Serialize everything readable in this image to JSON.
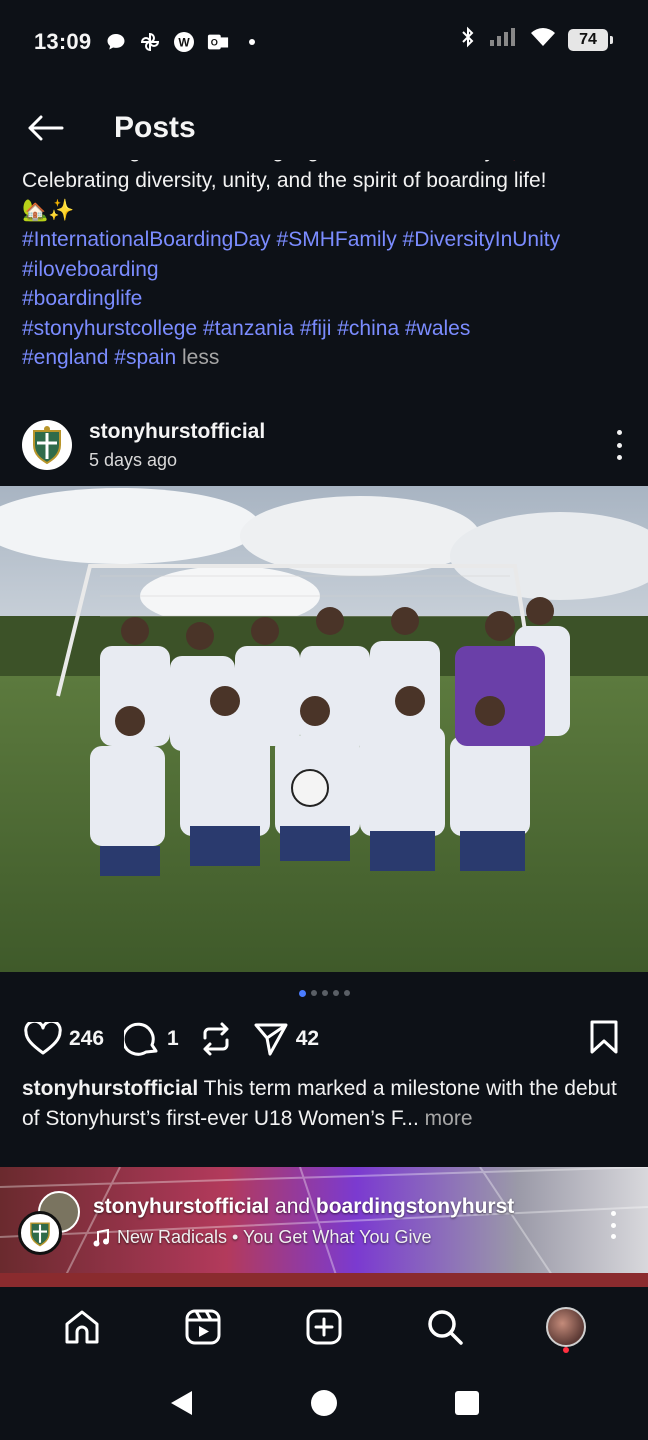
{
  "status_bar": {
    "time": "13:09",
    "battery": "74",
    "left_icons": [
      "chat-bubble-icon",
      "pinwheel-icon",
      "w-app-icon",
      "outlook-icon",
      "dot-icon"
    ],
    "right_icons": [
      "bluetooth-icon",
      "signal-icon",
      "wifi-icon",
      "battery-icon"
    ]
  },
  "header": {
    "title": "Posts"
  },
  "prev_post": {
    "caption_cut_line": "Different flags, different languages, one community ❤️",
    "caption_line": "Celebrating diversity, unity, and the spirit of boarding life!",
    "emoji_line": "🏡✨",
    "hashtags": {
      "h1": "#InternationalBoardingDay",
      "h2": "#SMHFamily",
      "h3": "#DiversityInUnity",
      "h4": "#iloveboarding",
      "h5": "#boardinglife",
      "h6": "#stonyhurstcollege",
      "h7": "#tanzania",
      "h8": "#fiji",
      "h9": "#china",
      "h10": "#wales",
      "h11": "#england",
      "h12": "#spain"
    },
    "less_label": "less"
  },
  "post": {
    "username": "stonyhurstofficial",
    "time_ago": "5 days ago",
    "photo_description_icon": "team-photo",
    "carousel": {
      "count": 5,
      "active": 1
    },
    "likes": "246",
    "comments": "1",
    "shares": "42",
    "caption_user": "stonyhurstofficial",
    "caption_text": " This term marked a milestone with the debut of Stonyhurst’s first-ever U18 Women’s F...",
    "more_label": " more"
  },
  "next_post": {
    "user1": "stonyhurstofficial",
    "and_text": " and ",
    "user2": "boardingstonyhurst",
    "song": "New Radicals • You Get What You Give"
  },
  "bottom_nav": {
    "items": [
      "home-icon",
      "reels-icon",
      "create-icon",
      "search-icon",
      "profile-avatar"
    ]
  },
  "colors": {
    "background": "#0d1117",
    "hashtag": "#7b8cff",
    "accent_dot": "#4a7dff",
    "notification": "#ff3040"
  }
}
